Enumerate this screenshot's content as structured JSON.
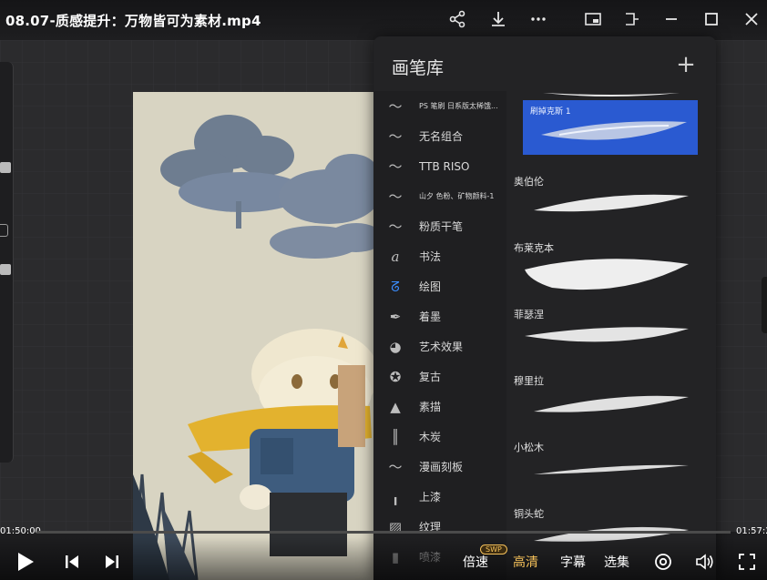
{
  "video": {
    "title": "08.07-质感提升：万物皆可为素材.mp4",
    "time_current": "01:50:00",
    "time_total": "01:57:2",
    "progress": 0.0
  },
  "brush_library": {
    "title": "画笔库",
    "add_label": "+",
    "categories": [
      {
        "label": "PS 笔刷 日系版太稀饿...",
        "icon": "brush-stroke-icon"
      },
      {
        "label": "无名组合",
        "icon": "brush-stroke-icon"
      },
      {
        "label": "TTB RISO",
        "icon": "brush-stroke-icon"
      },
      {
        "label": "山夕 色粉、矿物颜料-1",
        "icon": "brush-stroke-icon"
      },
      {
        "label": "粉质干笔",
        "icon": "brush-stroke-icon"
      },
      {
        "label": "书法",
        "icon": "calligraphy-icon"
      },
      {
        "label": "绘图",
        "icon": "drawing-icon"
      },
      {
        "label": "着墨",
        "icon": "ink-pen-icon"
      },
      {
        "label": "艺术效果",
        "icon": "palette-icon"
      },
      {
        "label": "复古",
        "icon": "star-badge-icon"
      },
      {
        "label": "素描",
        "icon": "pencil-tip-icon"
      },
      {
        "label": "木炭",
        "icon": "charcoal-icon"
      },
      {
        "label": "漫画刻板",
        "icon": "brush-stroke-icon"
      },
      {
        "label": "上漆",
        "icon": "paint-brush-icon"
      },
      {
        "label": "纹理",
        "icon": "texture-icon"
      },
      {
        "label": "喷漆",
        "icon": "spray-can-icon"
      }
    ],
    "selected_brush": "刷掉克斯 1",
    "brushes": [
      "奥伯伦",
      "布莱克本",
      "菲瑟涅",
      "穆里拉",
      "小松木",
      "铜头蛇"
    ]
  },
  "controls": {
    "speed": "倍速",
    "speed_badge": "SWP",
    "quality": "高清",
    "subtitle": "字幕",
    "episodes": "选集"
  },
  "colors": {
    "accent": "#2f8cff",
    "selected_brush_bg": "#2a5ad1",
    "quality_active": "#f5c15a"
  }
}
